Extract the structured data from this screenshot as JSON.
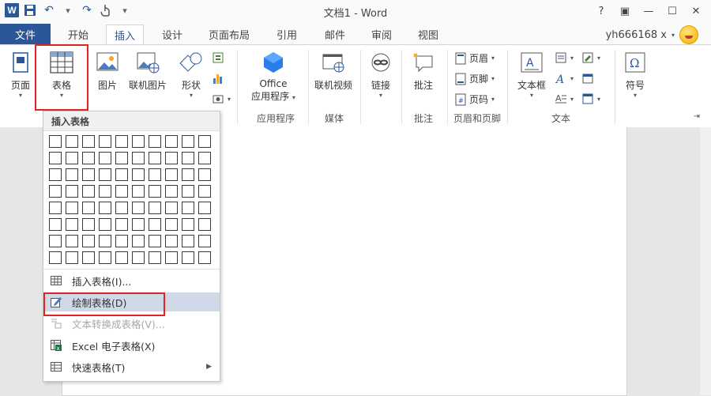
{
  "window": {
    "title": "文档1 - Word",
    "controls": [
      "?",
      "▣",
      "—",
      "☐",
      "✕"
    ]
  },
  "qat": {
    "app_icon": "W",
    "save_icon": "save-icon",
    "undo_icon": "undo-icon",
    "redo_icon": "redo-icon",
    "touch_icon": "touch-mode-icon",
    "more_icon": "customize-icon"
  },
  "tabs": {
    "file": "文件",
    "items": [
      "开始",
      "插入",
      "设计",
      "页面布局",
      "引用",
      "邮件",
      "审阅",
      "视图"
    ],
    "active": "插入"
  },
  "user": {
    "name": "yh666168 x",
    "dropdown": "▾"
  },
  "ribbon": {
    "pages": {
      "label": "页面"
    },
    "table": {
      "label": "表格"
    },
    "picture": {
      "label": "图片"
    },
    "online_picture": {
      "label": "联机图片"
    },
    "shapes": {
      "label": "形状"
    },
    "office_apps": {
      "label1": "Office",
      "label2": "应用程序",
      "group": "应用程序"
    },
    "online_video": {
      "label": "联机视频",
      "group": "媒体"
    },
    "links": {
      "label": "链接"
    },
    "comment": {
      "label": "批注",
      "group": "批注"
    },
    "header": {
      "label": "页眉"
    },
    "footer": {
      "label": "页脚"
    },
    "page_number": {
      "label": "页码"
    },
    "header_footer_group": "页眉和页脚",
    "textbox": {
      "label": "文本框"
    },
    "text_group": "文本",
    "symbols": {
      "label": "符号"
    }
  },
  "dropdown": {
    "header": "插入表格",
    "grid": {
      "cols": 10,
      "rows": 8
    },
    "items": [
      {
        "label": "插入表格(I)...",
        "icon": "insert-table-icon",
        "state": "normal"
      },
      {
        "label": "绘制表格(D)",
        "icon": "draw-table-icon",
        "state": "highlighted"
      },
      {
        "label": "文本转换成表格(V)...",
        "icon": "convert-text-icon",
        "state": "disabled"
      },
      {
        "label": "Excel 电子表格(X)",
        "icon": "excel-sheet-icon",
        "state": "normal"
      },
      {
        "label": "快速表格(T)",
        "icon": "quick-tables-icon",
        "state": "normal",
        "submenu": true
      }
    ]
  },
  "colors": {
    "word_blue": "#2b579a",
    "highlight_red": "#e02424",
    "menu_highlight": "#cfd9e8"
  }
}
